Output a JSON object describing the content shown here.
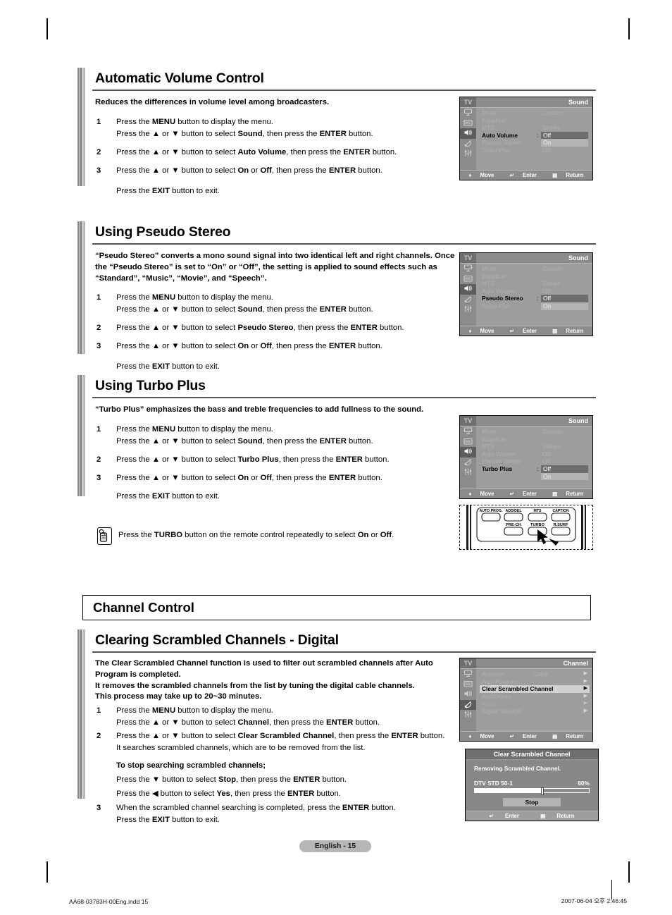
{
  "sections": {
    "avc": {
      "title": "Automatic Volume Control",
      "lead": "Reduces the differences in volume level among broadcasters.",
      "steps": [
        {
          "num": "1",
          "line1_a": "Press the ",
          "line1_b": "MENU",
          "line1_c": " button to display the menu.",
          "line2_a": "Press the ▲ or ▼ button to select ",
          "line2_b": "Sound",
          "line2_c": ", then press the ",
          "line2_d": "ENTER",
          "line2_e": " button."
        },
        {
          "num": "2",
          "line1_a": "Press the ▲ or ▼ button to select ",
          "line1_b": "Auto Volume",
          "line1_c": ", then press the ",
          "line1_d": "ENTER",
          "line1_e": " button."
        },
        {
          "num": "3",
          "line1_a": "Press the ▲ or ▼ button to select ",
          "line1_b": "On",
          "line1_c": " or ",
          "line1_d": "Off",
          "line1_e": ", then press the ",
          "line1_f": "ENTER",
          "line1_g": " button."
        }
      ],
      "exit_a": "Press the ",
      "exit_b": "EXIT",
      "exit_c": " button to exit."
    },
    "pseudo": {
      "title": "Using Pseudo Stereo",
      "lead": "“Pseudo Stereo” converts a mono sound signal into two identical left and right channels. Once the “Pseudo Stereo” is set to “On” or “Off”, the setting is applied to sound effects such as “Standard”, “Music”, “Movie”, and “Speech”.",
      "step2_target": "Pseudo Stereo"
    },
    "turbo": {
      "title": "Using Turbo Plus",
      "lead": "“Turbo Plus” emphasizes the bass and treble frequencies to add fullness to the sound.",
      "step2_target": "Turbo Plus"
    },
    "tip": {
      "a": "Press the ",
      "b": "TURBO",
      "c": " button on the remote control repeatedly to select ",
      "d": "On",
      "e": " or ",
      "f": "Off",
      "g": "."
    },
    "chapter": {
      "title": "Channel Control"
    },
    "scrambled": {
      "title": "Clearing Scrambled Channels - Digital",
      "lead_l1": "The Clear Scrambled Channel function is used to filter out scrambled channels after Auto",
      "lead_l2": "Program is completed.",
      "lead_l3": "It removes the scrambled channels from the list by tuning the digital cable channels.",
      "lead_l4": "This process may take up to 20~30 minutes.",
      "s1_a": "Press the ",
      "s1_b": "MENU",
      "s1_c": " button to display the menu.",
      "s1_d": "Press the ▲ or ▼ button to select ",
      "s1_e": "Channel",
      "s1_f": ", then press the ",
      "s1_g": "ENTER",
      "s1_h": " button.",
      "s2_a": "Press the ▲ or ▼ button to select ",
      "s2_b": "Clear Scrambled Channel",
      "s2_c": ", then press the ",
      "s2_d": "ENTER",
      "s2_e": " button.",
      "s2_note": "It searches scrambled channels, which are to be removed from the list.",
      "stop_head": "To stop searching scrambled channels;",
      "stop_l1_a": "Press the ▼ button to select ",
      "stop_l1_b": "Stop",
      "stop_l1_c": ", then press the ",
      "stop_l1_d": "ENTER",
      "stop_l1_e": " button.",
      "stop_l2_a": "Press the ◀ button to select ",
      "stop_l2_b": "Yes",
      "stop_l2_c": ", then press the  ",
      "stop_l2_d": "ENTER",
      "stop_l2_e": " button.",
      "s3_a": "When the scrambled channel searching is completed, press the ",
      "s3_b": "ENTER",
      "s3_c": " button.",
      "s3_exit_a": "Press the ",
      "s3_exit_b": "EXIT",
      "s3_exit_c": " button to exit."
    }
  },
  "osd_common": {
    "tv_label": "TV",
    "foot_move": "Move",
    "foot_enter": "Enter",
    "foot_return": "Return"
  },
  "osd_sound_1": {
    "title": "Sound",
    "rows": [
      {
        "label": "Mode",
        "colon": ":",
        "value": "Custom",
        "state": "dim"
      },
      {
        "label": "Equalizer",
        "colon": "",
        "value": "",
        "state": "dim"
      },
      {
        "label": "MTS",
        "colon": ":",
        "value": "Stereo",
        "state": "dim"
      },
      {
        "label": "Auto Volume",
        "colon": ":",
        "value": "Off",
        "state": "active-chip"
      },
      {
        "label": "Pseudo Stereo",
        "colon": ":",
        "value": "On",
        "state": "dim-chip"
      },
      {
        "label": "Turbo Plus",
        "colon": ":",
        "value": "Off",
        "state": "dim"
      }
    ]
  },
  "osd_sound_2": {
    "title": "Sound",
    "rows": [
      {
        "label": "Mode",
        "colon": ":",
        "value": "Custom",
        "state": "dim"
      },
      {
        "label": "Equalizer",
        "colon": "",
        "value": "",
        "state": "dim"
      },
      {
        "label": "MTS",
        "colon": ":",
        "value": "Stereo",
        "state": "dim"
      },
      {
        "label": "Auto Volume",
        "colon": ":",
        "value": "Off",
        "state": "dim"
      },
      {
        "label": "Pseudo Stereo",
        "colon": ":",
        "value": "Off",
        "state": "active-chip"
      },
      {
        "label": "Turbo Plus",
        "colon": ":",
        "value": "On",
        "state": "dim-chip"
      }
    ]
  },
  "osd_sound_3": {
    "title": "Sound",
    "rows": [
      {
        "label": "Mode",
        "colon": ":",
        "value": "Custom",
        "state": "dim"
      },
      {
        "label": "Equalizer",
        "colon": "",
        "value": "",
        "state": "dim"
      },
      {
        "label": "MTS",
        "colon": ":",
        "value": "Stereo",
        "state": "dim"
      },
      {
        "label": "Auto Volume",
        "colon": ":",
        "value": "Off",
        "state": "dim"
      },
      {
        "label": "Pseudo Stereo",
        "colon": ":",
        "value": "Off",
        "state": "dim"
      },
      {
        "label": "Turbo Plus",
        "colon": ":",
        "value": "Off",
        "state": "active-chip"
      },
      {
        "label": "",
        "colon": "",
        "value": "On",
        "state": "dim-chip"
      }
    ]
  },
  "osd_channel": {
    "title": "Channel",
    "rows": [
      {
        "label": "Antenna",
        "colon": ":",
        "value": "Cable",
        "arrow": "▶",
        "state": "dim"
      },
      {
        "label": "Auto Program",
        "colon": "",
        "value": "",
        "arrow": "▶",
        "state": "dim"
      },
      {
        "label": "Clear Scrambled Channel",
        "colon": "",
        "value": "",
        "arrow": "▶",
        "state": "rowhl"
      },
      {
        "label": "Add/Delete",
        "colon": "",
        "value": "",
        "arrow": "▶",
        "state": "dim"
      },
      {
        "label": "Name",
        "colon": "",
        "value": "",
        "arrow": "▶",
        "state": "dimmer"
      },
      {
        "label": "Signal Strength",
        "colon": "",
        "value": "",
        "arrow": "▶",
        "state": "dim"
      }
    ]
  },
  "dialog": {
    "title": "Clear Scrambled Channel",
    "message": "Removing Scrambled Channel.",
    "channel": "DTV STD 50-1",
    "percent": "60%",
    "percent_value": 60,
    "stop_label": "Stop",
    "foot_enter": "Enter",
    "foot_return": "Return"
  },
  "remote": {
    "buttons_row1": [
      "AUTO PROG.",
      "ADD/DEL",
      "MTS",
      "CAPTION"
    ],
    "buttons_row2": [
      "PRE-CH",
      "TURBO",
      "R.SURF"
    ]
  },
  "footer": {
    "page_label": "English - 15",
    "imprint_left": "AA68-03783H-00Eng.indd   15",
    "imprint_right": "2007-06-04   오후 2:46:45"
  }
}
